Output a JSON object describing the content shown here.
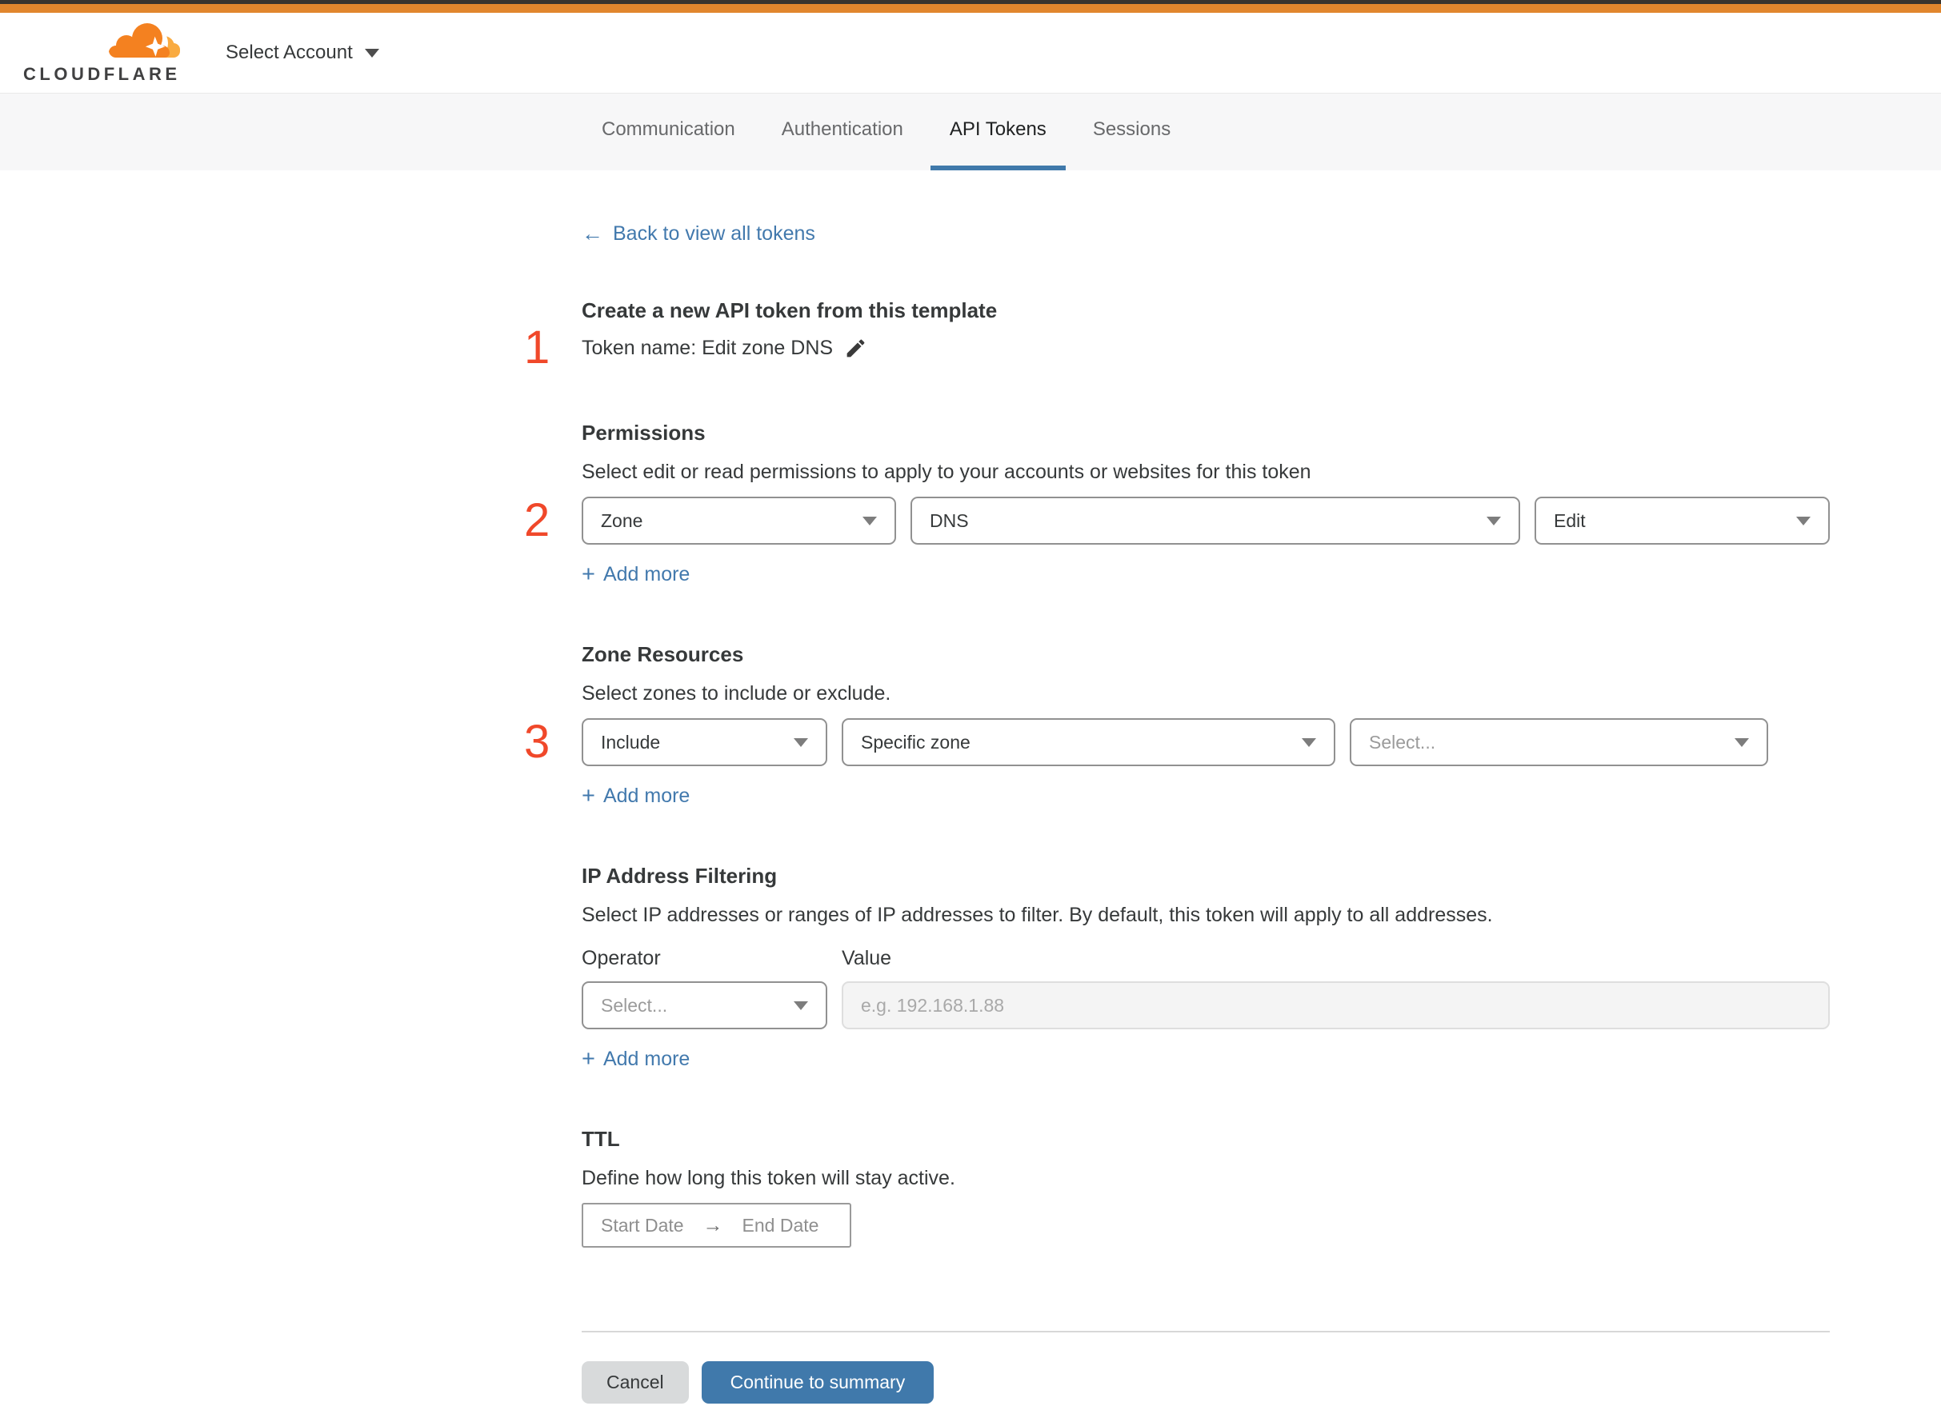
{
  "colors": {
    "topbar-orange": "#e1862d",
    "logo-orange": "#f48120",
    "logo-orange-light": "#f9ab41",
    "link-blue": "#4279ad",
    "button-blue": "#4079ab",
    "marker-red": "#f0482a",
    "text-dark": "#36393a"
  },
  "header": {
    "brand": "CLOUDFLARE",
    "account_selector": "Select Account"
  },
  "tabs": [
    {
      "label": "Communication"
    },
    {
      "label": "Authentication"
    },
    {
      "label": "API Tokens"
    },
    {
      "label": "Sessions"
    }
  ],
  "back_link": {
    "arrow": "←",
    "label": "Back to view all tokens"
  },
  "token_section": {
    "marker": "1",
    "heading": "Create a new API token from this template",
    "token_name_line": "Token name: Edit zone DNS"
  },
  "permissions": {
    "marker": "2",
    "heading": "Permissions",
    "description": "Select edit or read permissions to apply to your accounts or websites for this token",
    "selects": [
      "Zone",
      "DNS",
      "Edit"
    ],
    "add_more": "Add more"
  },
  "zone_resources": {
    "marker": "3",
    "heading": "Zone Resources",
    "description": "Select zones to include or exclude.",
    "selects": [
      "Include",
      "Specific zone",
      "Select..."
    ],
    "add_more": "Add more"
  },
  "ip_filtering": {
    "heading": "IP Address Filtering",
    "description": "Select IP addresses or ranges of IP addresses to filter. By default, this token will apply to all addresses.",
    "operator_label": "Operator",
    "value_label": "Value",
    "operator_value": "Select...",
    "value_placeholder": "e.g. 192.168.1.88",
    "add_more": "Add more"
  },
  "ttl": {
    "heading": "TTL",
    "description": "Define how long this token will stay active.",
    "start_date": "Start Date",
    "end_date": "End Date",
    "arrow": "→"
  },
  "footer": {
    "cancel": "Cancel",
    "continue": "Continue to summary"
  },
  "misc": {
    "plus": "+"
  }
}
